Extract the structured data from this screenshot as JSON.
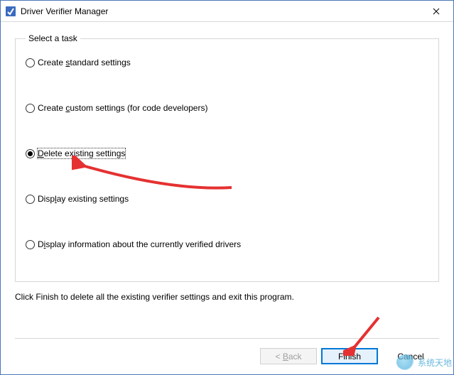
{
  "colors": {
    "window_border": "#4a78b8",
    "highlight": "#0078d7",
    "arrow": "#e53131"
  },
  "titlebar": {
    "title": "Driver Verifier Manager",
    "icon_name": "verifier-icon"
  },
  "group": {
    "legend": "Select a task",
    "options": [
      {
        "label_pre": "Create ",
        "label_mn": "s",
        "label_post": "tandard settings",
        "checked": false
      },
      {
        "label_pre": "Create ",
        "label_mn": "c",
        "label_post": "ustom settings (for code developers)",
        "checked": false
      },
      {
        "label_pre": "",
        "label_mn": "D",
        "label_post": "elete existing settings",
        "checked": true
      },
      {
        "label_pre": "Disp",
        "label_mn": "l",
        "label_post": "ay existing settings",
        "checked": false
      },
      {
        "label_pre": "D",
        "label_mn": "i",
        "label_post": "splay information about the currently verified drivers",
        "checked": false
      }
    ]
  },
  "hint": "Click Finish to delete all the existing verifier settings and exit this program.",
  "buttons": {
    "back_pre": "< ",
    "back_mn": "B",
    "back_post": "ack",
    "finish": "Finish",
    "cancel": "Cancel"
  },
  "watermark": "系统天地"
}
